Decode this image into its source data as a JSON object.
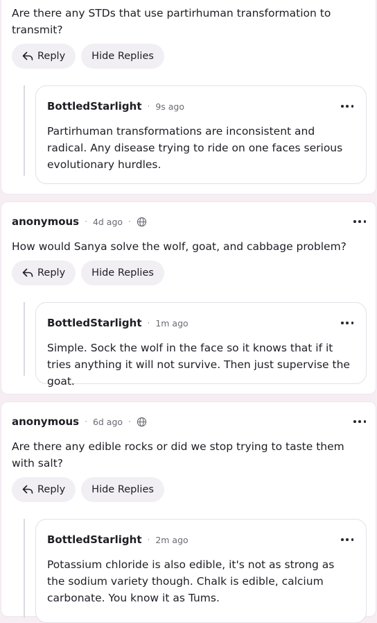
{
  "threads": [
    {
      "question": "Are there any STDs that use partirhuman transformation to transmit?",
      "reply_label": "Reply",
      "hide_label": "Hide Replies",
      "reply": {
        "author": "BottledStarlight",
        "time": "9s ago",
        "text": "Partirhuman transformations are inconsistent and radical. Any disease trying to ride on one faces serious evolutionary hurdles."
      }
    },
    {
      "author": "anonymous",
      "time": "4d ago",
      "question": "How would Sanya solve the wolf, goat, and cabbage problem?",
      "reply_label": "Reply",
      "hide_label": "Hide Replies",
      "reply": {
        "author": "BottledStarlight",
        "time": "1m ago",
        "text": "Simple. Sock the wolf in the face so it knows that if it tries anything it will not survive. Then just supervise the goat."
      }
    },
    {
      "author": "anonymous",
      "time": "6d ago",
      "question": "Are there any edible rocks or did we stop trying to taste them with salt?",
      "reply_label": "Reply",
      "hide_label": "Hide Replies",
      "reply": {
        "author": "BottledStarlight",
        "time": "2m ago",
        "text": "Potassium chloride is also edible, it's not as strong as the sodium variety though. Chalk is edible, calcium carbonate. You know it as Tums."
      }
    }
  ],
  "icons": {
    "reply": "reply-arrow-icon",
    "globe": "globe-icon",
    "more": "more-horizontal-icon"
  }
}
